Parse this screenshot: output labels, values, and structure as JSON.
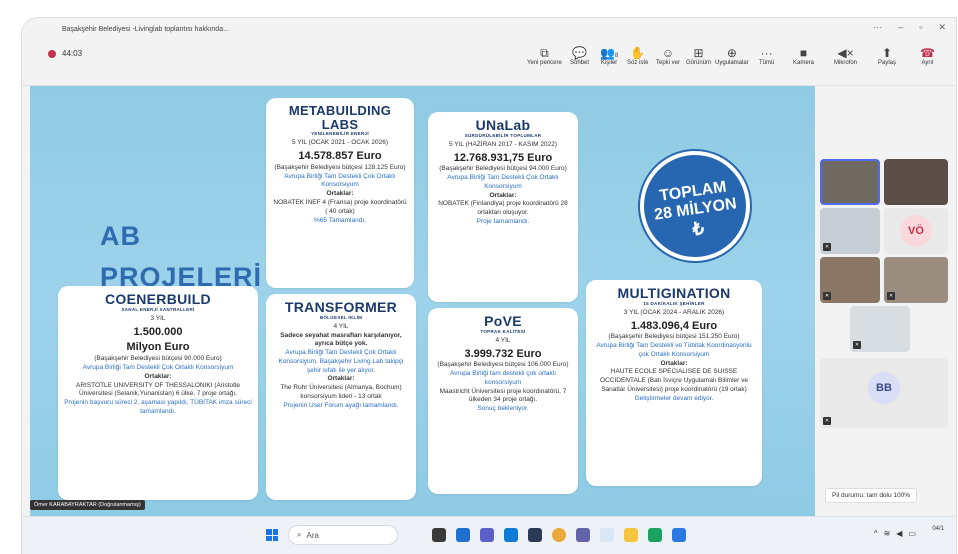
{
  "window": {
    "title": "Başakşehir Belediyesi -Livinglab toplantısı hakkında..."
  },
  "toolbar": {
    "timer": "44:03",
    "buttons": [
      {
        "label": "Yeni pencere",
        "icon": "new-window-icon"
      },
      {
        "label": "Sohbet",
        "icon": "chat-icon"
      },
      {
        "label": "Kişiler",
        "icon": "people-icon",
        "count": "8"
      },
      {
        "label": "Söz iste",
        "icon": "raise-hand-icon"
      },
      {
        "label": "Tepki ver",
        "icon": "react-icon"
      },
      {
        "label": "Görünüm",
        "icon": "view-icon"
      },
      {
        "label": "Uygulamalar",
        "icon": "apps-icon"
      },
      {
        "label": "Tümü",
        "icon": "more-icon"
      },
      {
        "label": "Kamera",
        "icon": "camera-off-icon"
      },
      {
        "label": "Mikrofon",
        "icon": "mic-mute-icon"
      },
      {
        "label": "Paylaş",
        "icon": "share-icon"
      },
      {
        "label": "Ayrıl",
        "icon": "leave-icon"
      }
    ]
  },
  "slide": {
    "heading_1": "AB",
    "heading_2": "PROJELERİ",
    "badge": {
      "l1": "TOPLAM",
      "l2": "28 MİLYON",
      "l3": "₺"
    },
    "metabuilding": {
      "title": "METABUILDING LABS",
      "subtitle": "YENİLENEBİLİR ENERJİ",
      "period": "5 YIL (OCAK 2021 - OCAK 2026)",
      "amount": "14.578.857 Euro",
      "budget": "(Başakşehir Belediyesi bütçesi 128.125 Euro)",
      "support": "Avrupa Birliği Tam Destekli Çok Ortaklı Konsorsiyum",
      "partners_label": "Ortaklar:",
      "partners": "NOBATEK İNEF 4 (Fransa) proje koordinatörü ( 40 ortak)",
      "status": "%65 Tamamlandı."
    },
    "unalab": {
      "title": "UNaLab",
      "subtitle": "SÜRDÜRÜLEBİLİR TOPLUMLAR",
      "period": "5 YIL (HAZİRAN 2017 - KASIM 2022)",
      "amount": "12.768.931,75 Euro",
      "budget": "(Başakşehir Belediyesi bütçesi 94.000 Euro)",
      "support": "Avrupa Birliği Tam Destekli Çok Ortaklı Konsorsiyum",
      "partners_label": "Ortaklar:",
      "partners": "NOBATEK (Finlandiya) proje koordinatörü 28 ortaktan oluşuyor.",
      "status": "Proje tamamlandı."
    },
    "coenerbuild": {
      "title": "COENERBUILD",
      "subtitle": "SANAL ENERJİ SANTRALLERİ",
      "period": "3 YIL",
      "amount_1": "1.500.000",
      "amount_2": "Milyon Euro",
      "budget": "(Başakşehir Belediyesi bütçesi 90.000 Euro)",
      "support": "Avrupa Birliği Tam Destekli Çok Ortaklı Konsorsiyum",
      "partners_label": "Ortaklar:",
      "partners": "ARISTOTLE UNIVERSITY OF THESSALONIKI (Aristotle Üniversitesi (Selanik,Yunanistan) 6 ülke, 7 proje ortağı,",
      "status": "Projenin başvuru süreci 2. aşaması yapıldı, TÜBİTAK imza süreci tamamlandı."
    },
    "transformer": {
      "title": "TRANSFORMER",
      "subtitle": "BÖLGESEL İKLİM",
      "period": "4 YIL",
      "note": "Sadece seyahat masrafları karşılanıyor, ayrıca bütçe yok.",
      "support": "Avrupa Birliği Tam Destekli Çok Ortaklı Konsorsiyum. Başakşehir Living Lab takipçi şehir sıfatı ile yer alıyor.",
      "partners_label": "Ortaklar:",
      "partners": "The Ruhr Üniversitesi (Almanya, Bochum) konsorsiyum lideri - 13 ortak",
      "status": "Projenin User Forum ayağı tamamlandı."
    },
    "pove": {
      "title": "PoVE",
      "subtitle": "TOPRAK KALİTESİ",
      "period": "4 YIL",
      "amount": "3.999.732 Euro",
      "budget": "(Başakşehir Belediyesi bütçesi 106.000 Euro)",
      "support": "Avrupa Birliği tam destekli çok ortaklı konsorsiyum",
      "partners": "Maastricht Üniversitesi proje koordinatörü, 7 ülkeden 34 proje ortağı.",
      "status": "Sonuç bekleniyor."
    },
    "multigination": {
      "title": "MULTIGINATION",
      "subtitle": "15 DAKİKALIK ŞEHİRLER",
      "period": "3 YIL (OCAK 2024 - ARALIK 2026)",
      "amount": "1.483.096,4 Euro",
      "budget": "(Başakşehir Belediyesi bütçesi 151.250 Euro)",
      "support": "Avrupa Birliği Tam Destekli ve Tübitak Koordinasyonlu çok Ortaklı Konsorsiyum",
      "partners_label": "Ortaklar:",
      "partners": "HAUTE ECOLE SPECIALISEE DE SUISSE OCCIDENTALE (Batı İsviçre Uygulamalı Bilimler ve Sanatlar Üniversitesi) proje koordinatörü (19 ortak)",
      "status": "Geliştirmeler devam ediyor."
    }
  },
  "speaker_label": "Ömer KARABAYRAKTAR (Doğrulanmamış)",
  "participants": {
    "vo": "VÖ",
    "bb": "BB"
  },
  "battery_tooltip": "Pil durumu: tam dolu 100%",
  "taskbar": {
    "search_placeholder": "Ara",
    "date": "04/1"
  },
  "colors": {
    "slide_bg": "#9dd3ea",
    "title_blue": "#1b3a6b",
    "accent_blue": "#2a6fc9",
    "badge": "#2766b0",
    "leave": "#c4314b"
  }
}
